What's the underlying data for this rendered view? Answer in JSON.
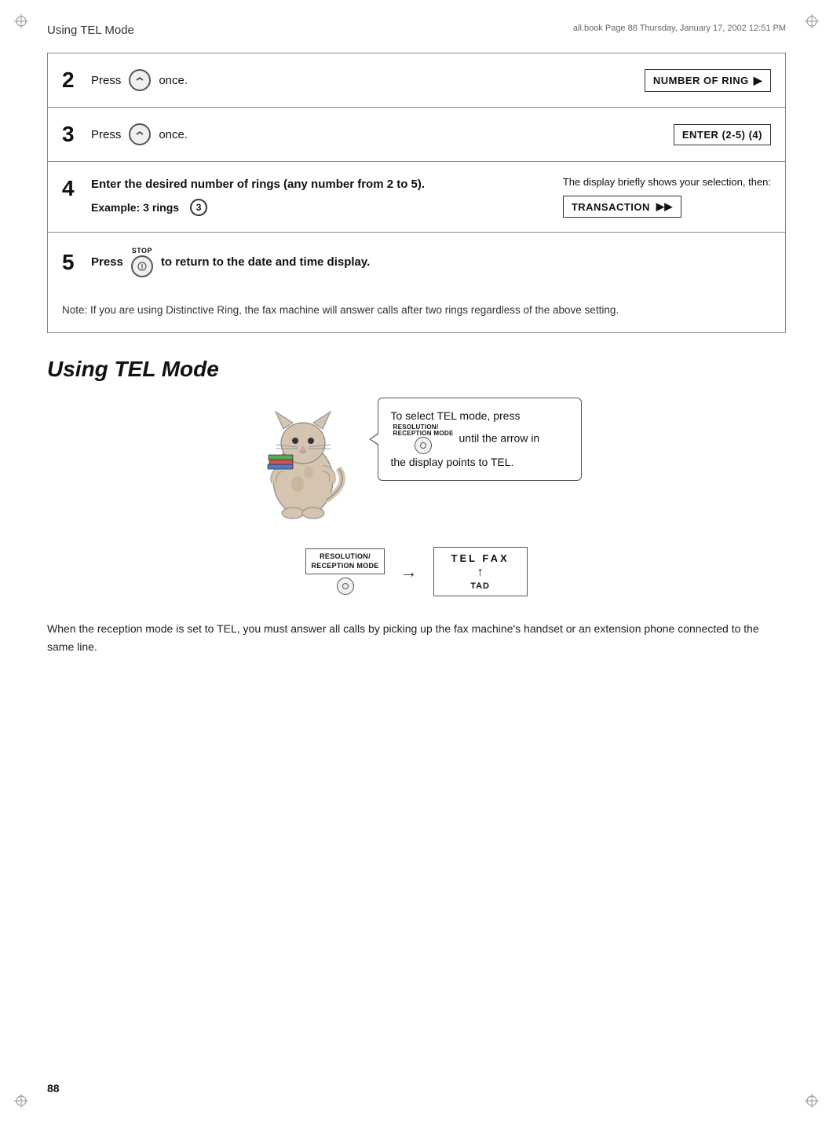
{
  "header": {
    "title": "Using TEL Mode",
    "meta": "all.book  Page 88  Thursday, January 17, 2002  12:51 PM"
  },
  "steps": [
    {
      "number": "2",
      "text_prefix": "Press",
      "text_suffix": "once.",
      "display_label": "NUMBER OF RING",
      "display_arrow": "▶"
    },
    {
      "number": "3",
      "text_prefix": "Press",
      "text_suffix": "once.",
      "display_label": "ENTER (2-5) (4)"
    },
    {
      "number": "4",
      "text_main": "Enter the desired number of rings (any number from 2 to 5).",
      "example_label": "Example: 3 rings",
      "example_number": "3",
      "display_desc": "The display briefly shows your selection, then:",
      "display_label": "TRANSACTION",
      "display_arrow": "▶▶"
    },
    {
      "number": "5",
      "text_prefix": "Press",
      "stop_label": "STOP",
      "text_suffix": "to return to the date and time display."
    }
  ],
  "note": "Note: If you are using Distinctive Ring, the fax machine will answer calls after two rings regardless of the above setting.",
  "section_title": "Using TEL Mode",
  "callout": {
    "line1": "To select TEL mode, press",
    "btn_label_line1": "RESOLUTION/",
    "btn_label_line2": "RECEPTION MODE",
    "line2": "until the arrow in",
    "line3": "the display points to TEL."
  },
  "bottom_diagram": {
    "label_line1": "RESOLUTION/",
    "label_line2": "RECEPTION MODE",
    "tel": "TEL  FAX",
    "tad": "TAD"
  },
  "body_text": "When the reception mode is set to TEL, you must answer all calls by picking up the fax machine's handset or an extension phone connected to the same line.",
  "page_number": "88"
}
